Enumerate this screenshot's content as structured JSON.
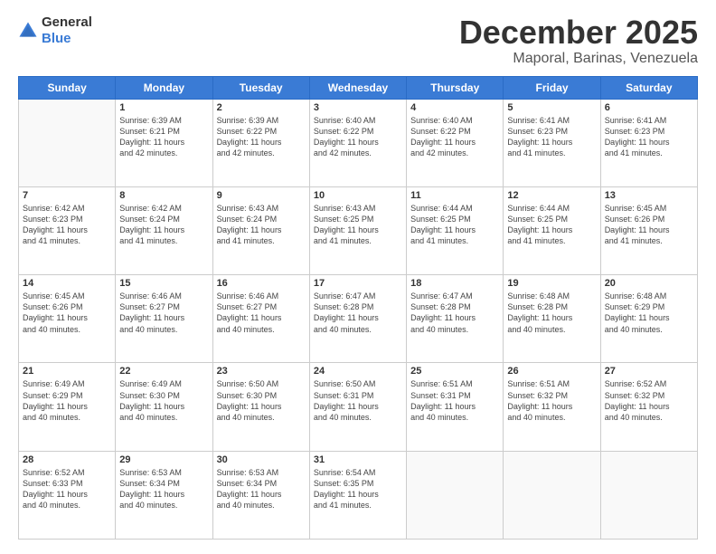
{
  "header": {
    "logo_general": "General",
    "logo_blue": "Blue",
    "month_title": "December 2025",
    "location": "Maporal, Barinas, Venezuela"
  },
  "days_of_week": [
    "Sunday",
    "Monday",
    "Tuesday",
    "Wednesday",
    "Thursday",
    "Friday",
    "Saturday"
  ],
  "weeks": [
    [
      {
        "day": "",
        "info": ""
      },
      {
        "day": "1",
        "info": "Sunrise: 6:39 AM\nSunset: 6:21 PM\nDaylight: 11 hours\nand 42 minutes."
      },
      {
        "day": "2",
        "info": "Sunrise: 6:39 AM\nSunset: 6:22 PM\nDaylight: 11 hours\nand 42 minutes."
      },
      {
        "day": "3",
        "info": "Sunrise: 6:40 AM\nSunset: 6:22 PM\nDaylight: 11 hours\nand 42 minutes."
      },
      {
        "day": "4",
        "info": "Sunrise: 6:40 AM\nSunset: 6:22 PM\nDaylight: 11 hours\nand 42 minutes."
      },
      {
        "day": "5",
        "info": "Sunrise: 6:41 AM\nSunset: 6:23 PM\nDaylight: 11 hours\nand 41 minutes."
      },
      {
        "day": "6",
        "info": "Sunrise: 6:41 AM\nSunset: 6:23 PM\nDaylight: 11 hours\nand 41 minutes."
      }
    ],
    [
      {
        "day": "7",
        "info": "Sunrise: 6:42 AM\nSunset: 6:23 PM\nDaylight: 11 hours\nand 41 minutes."
      },
      {
        "day": "8",
        "info": "Sunrise: 6:42 AM\nSunset: 6:24 PM\nDaylight: 11 hours\nand 41 minutes."
      },
      {
        "day": "9",
        "info": "Sunrise: 6:43 AM\nSunset: 6:24 PM\nDaylight: 11 hours\nand 41 minutes."
      },
      {
        "day": "10",
        "info": "Sunrise: 6:43 AM\nSunset: 6:25 PM\nDaylight: 11 hours\nand 41 minutes."
      },
      {
        "day": "11",
        "info": "Sunrise: 6:44 AM\nSunset: 6:25 PM\nDaylight: 11 hours\nand 41 minutes."
      },
      {
        "day": "12",
        "info": "Sunrise: 6:44 AM\nSunset: 6:25 PM\nDaylight: 11 hours\nand 41 minutes."
      },
      {
        "day": "13",
        "info": "Sunrise: 6:45 AM\nSunset: 6:26 PM\nDaylight: 11 hours\nand 41 minutes."
      }
    ],
    [
      {
        "day": "14",
        "info": "Sunrise: 6:45 AM\nSunset: 6:26 PM\nDaylight: 11 hours\nand 40 minutes."
      },
      {
        "day": "15",
        "info": "Sunrise: 6:46 AM\nSunset: 6:27 PM\nDaylight: 11 hours\nand 40 minutes."
      },
      {
        "day": "16",
        "info": "Sunrise: 6:46 AM\nSunset: 6:27 PM\nDaylight: 11 hours\nand 40 minutes."
      },
      {
        "day": "17",
        "info": "Sunrise: 6:47 AM\nSunset: 6:28 PM\nDaylight: 11 hours\nand 40 minutes."
      },
      {
        "day": "18",
        "info": "Sunrise: 6:47 AM\nSunset: 6:28 PM\nDaylight: 11 hours\nand 40 minutes."
      },
      {
        "day": "19",
        "info": "Sunrise: 6:48 AM\nSunset: 6:28 PM\nDaylight: 11 hours\nand 40 minutes."
      },
      {
        "day": "20",
        "info": "Sunrise: 6:48 AM\nSunset: 6:29 PM\nDaylight: 11 hours\nand 40 minutes."
      }
    ],
    [
      {
        "day": "21",
        "info": "Sunrise: 6:49 AM\nSunset: 6:29 PM\nDaylight: 11 hours\nand 40 minutes."
      },
      {
        "day": "22",
        "info": "Sunrise: 6:49 AM\nSunset: 6:30 PM\nDaylight: 11 hours\nand 40 minutes."
      },
      {
        "day": "23",
        "info": "Sunrise: 6:50 AM\nSunset: 6:30 PM\nDaylight: 11 hours\nand 40 minutes."
      },
      {
        "day": "24",
        "info": "Sunrise: 6:50 AM\nSunset: 6:31 PM\nDaylight: 11 hours\nand 40 minutes."
      },
      {
        "day": "25",
        "info": "Sunrise: 6:51 AM\nSunset: 6:31 PM\nDaylight: 11 hours\nand 40 minutes."
      },
      {
        "day": "26",
        "info": "Sunrise: 6:51 AM\nSunset: 6:32 PM\nDaylight: 11 hours\nand 40 minutes."
      },
      {
        "day": "27",
        "info": "Sunrise: 6:52 AM\nSunset: 6:32 PM\nDaylight: 11 hours\nand 40 minutes."
      }
    ],
    [
      {
        "day": "28",
        "info": "Sunrise: 6:52 AM\nSunset: 6:33 PM\nDaylight: 11 hours\nand 40 minutes."
      },
      {
        "day": "29",
        "info": "Sunrise: 6:53 AM\nSunset: 6:34 PM\nDaylight: 11 hours\nand 40 minutes."
      },
      {
        "day": "30",
        "info": "Sunrise: 6:53 AM\nSunset: 6:34 PM\nDaylight: 11 hours\nand 40 minutes."
      },
      {
        "day": "31",
        "info": "Sunrise: 6:54 AM\nSunset: 6:35 PM\nDaylight: 11 hours\nand 41 minutes."
      },
      {
        "day": "",
        "info": ""
      },
      {
        "day": "",
        "info": ""
      },
      {
        "day": "",
        "info": ""
      }
    ]
  ]
}
